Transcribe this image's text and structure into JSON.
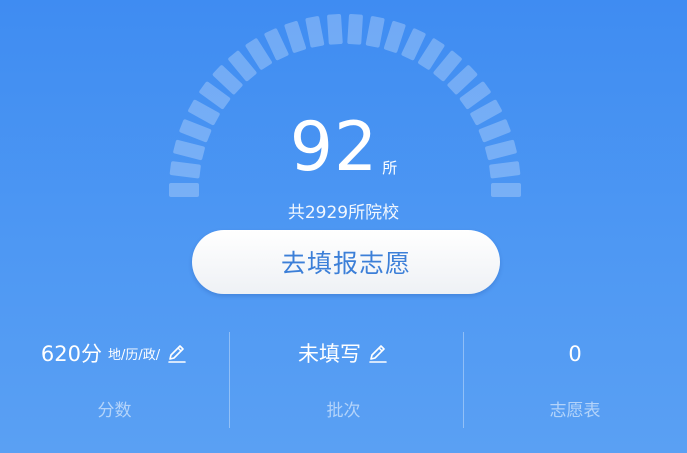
{
  "colors": {
    "background_top": "#3f8cf2",
    "background_bottom": "#5aa0f3",
    "button_text": "#3c7fd8",
    "gauge_segment": "#ffffff"
  },
  "gauge": {
    "segment_count": 26,
    "filled_fraction": 1.0
  },
  "result": {
    "count": "92",
    "unit": "所",
    "total_text": "共2929所院校"
  },
  "cta": {
    "label": "去填报志愿"
  },
  "stats": {
    "score": {
      "value": "620分",
      "subjects": "地/历/政/",
      "label": "分数",
      "edit_icon": "pencil-icon"
    },
    "batch": {
      "value": "未填写",
      "label": "批次",
      "edit_icon": "pencil-icon"
    },
    "plan": {
      "value": "0",
      "label": "志愿表"
    }
  }
}
